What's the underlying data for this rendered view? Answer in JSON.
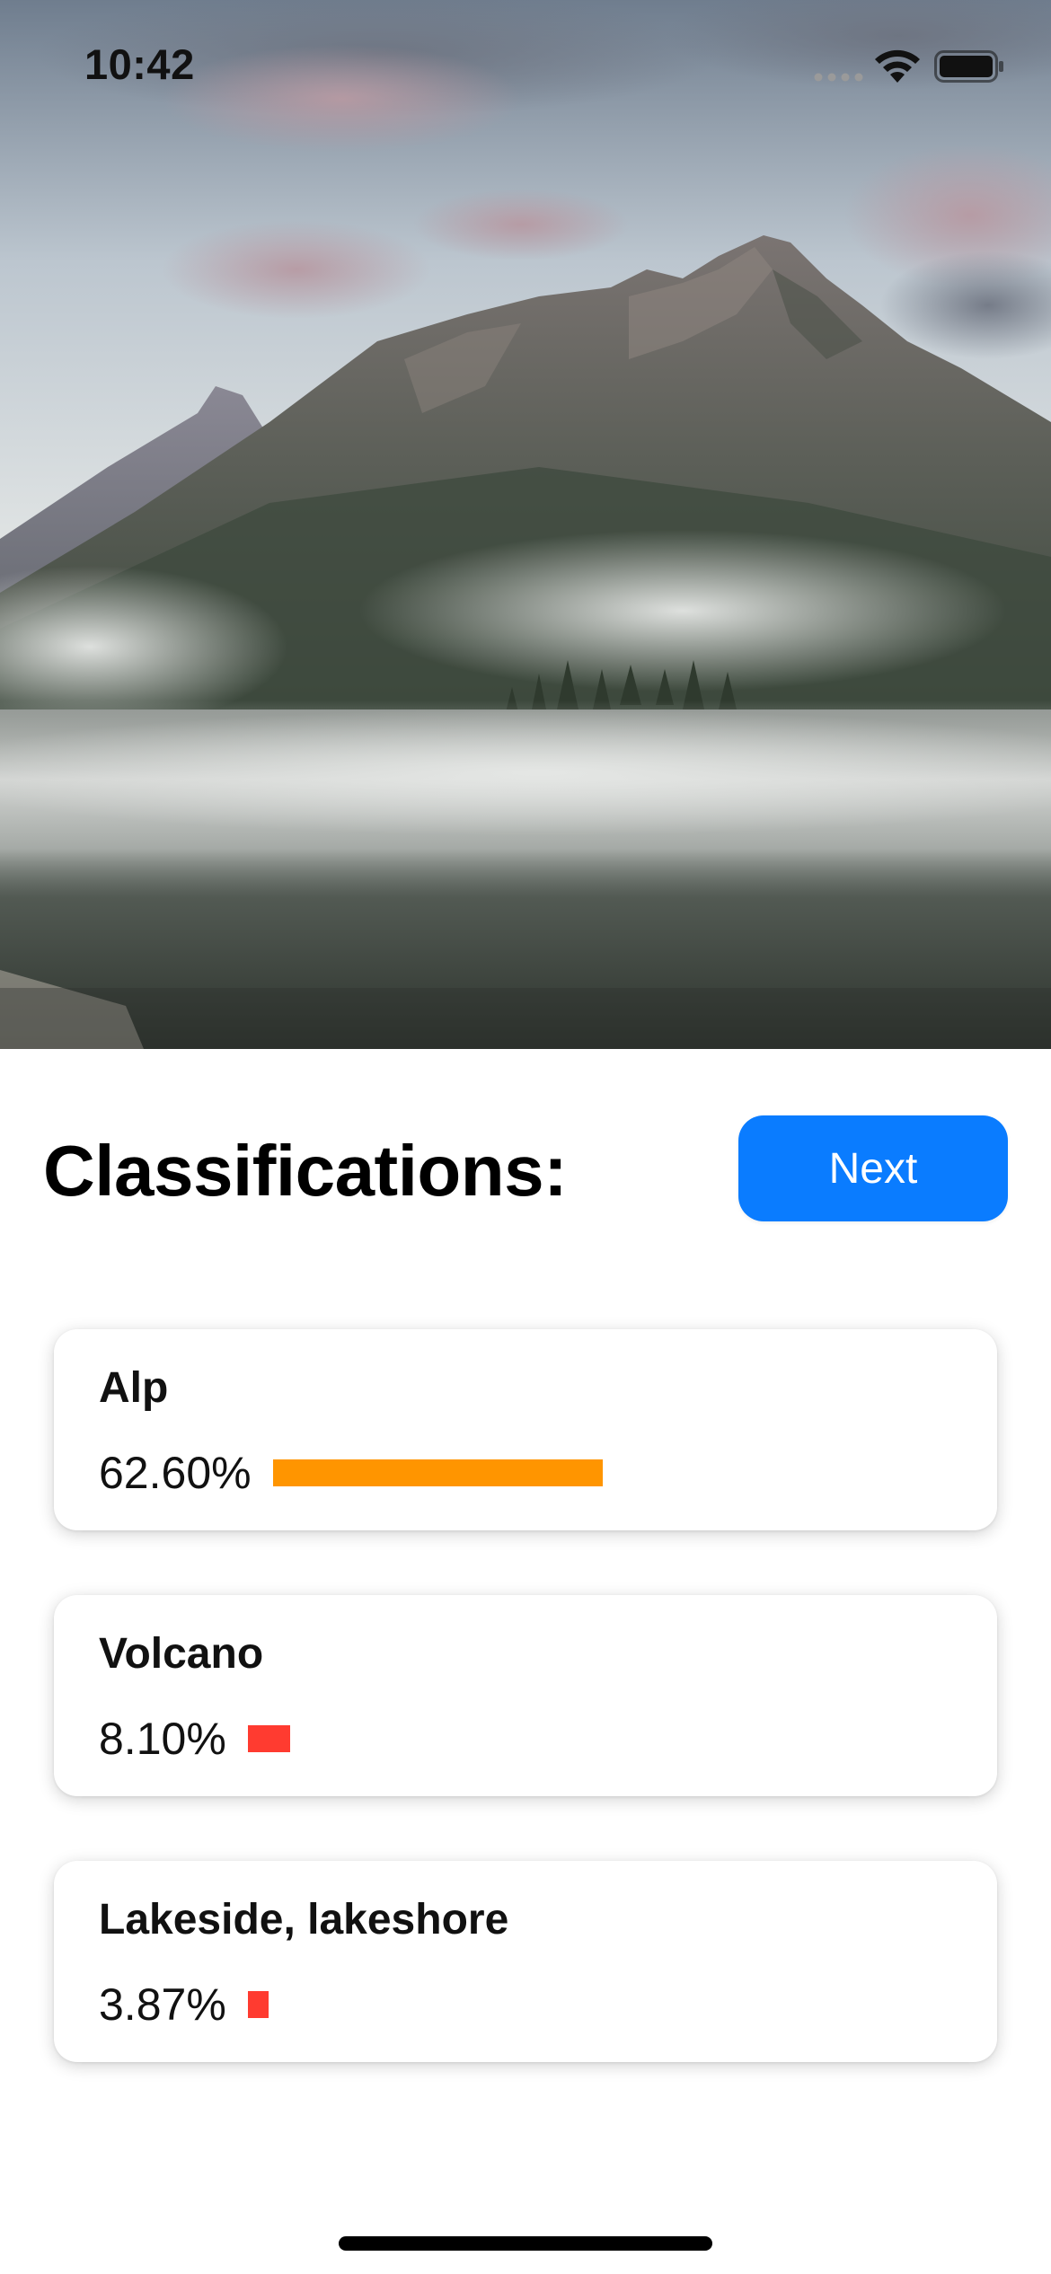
{
  "status_bar": {
    "time": "10:42",
    "icons": [
      "cellular-signal-icon",
      "wifi-icon",
      "battery-icon"
    ]
  },
  "hero_image": {
    "description_icon": "mountain-lake-photo"
  },
  "header": {
    "title": "Classifications:",
    "next_label": "Next"
  },
  "colors": {
    "accent": "#0a7cff",
    "high_confidence": "#ff9500",
    "low_confidence": "#ff3b30"
  },
  "classifications": [
    {
      "label": "Alp",
      "percent_text": "62.60%",
      "value": 0.626,
      "color": "#ff9500"
    },
    {
      "label": "Volcano",
      "percent_text": "8.10%",
      "value": 0.081,
      "color": "#ff3b30"
    },
    {
      "label": "Lakeside, lakeshore",
      "percent_text": "3.87%",
      "value": 0.0387,
      "color": "#ff3b30"
    }
  ]
}
